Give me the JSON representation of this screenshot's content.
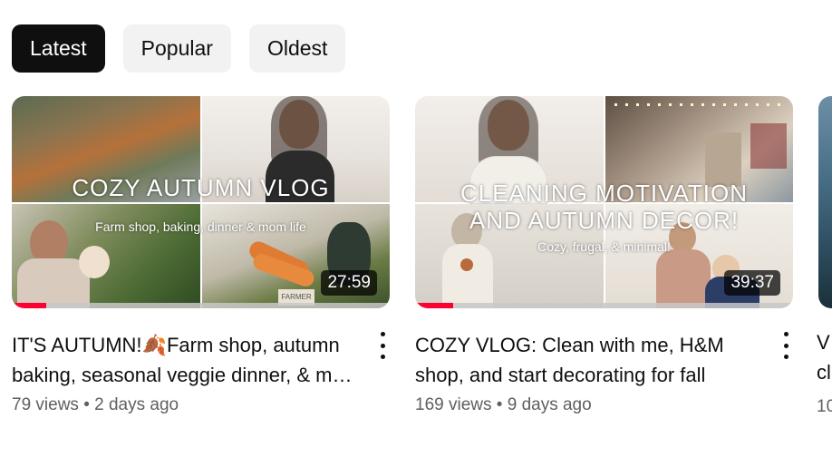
{
  "filters": [
    {
      "label": "Latest",
      "active": true
    },
    {
      "label": "Popular",
      "active": false
    },
    {
      "label": "Oldest",
      "active": false
    }
  ],
  "videos": [
    {
      "thumb_title": "COZY AUTUMN VLOG",
      "thumb_subtitle": "Farm shop, baking, dinner & mom life",
      "thumb_sign": "FARMER",
      "duration": "27:59",
      "watched_fraction": 0.09,
      "title_prefix": "IT'S AUTUMN!",
      "title_emoji": "🍂",
      "title_suffix": "Farm shop, autumn baking, seasonal veggie dinner, & mom life",
      "views": "79 views",
      "age": "2 days ago"
    },
    {
      "thumb_title_line1": "CLEANING MOTIVATION",
      "thumb_title_line2": "AND AUTUMN DECOR!",
      "thumb_subtitle": "Cozy, frugal, & minimal!",
      "duration": "39:37",
      "watched_fraction": 0.1,
      "title": "COZY VLOG: Clean with me, H&M shop, and start decorating for fall",
      "views": "169 views",
      "age": "9 days ago"
    },
    {
      "title_line1": "V",
      "title_line2": "cl",
      "meta": "10"
    }
  ],
  "meta_separator": "•",
  "icons": {
    "more": "vertical-ellipsis-icon"
  },
  "colors": {
    "chip_active_bg": "#0f0f0f",
    "chip_bg": "#f2f2f2",
    "progress": "#ff0033",
    "meta_text": "#606060"
  }
}
